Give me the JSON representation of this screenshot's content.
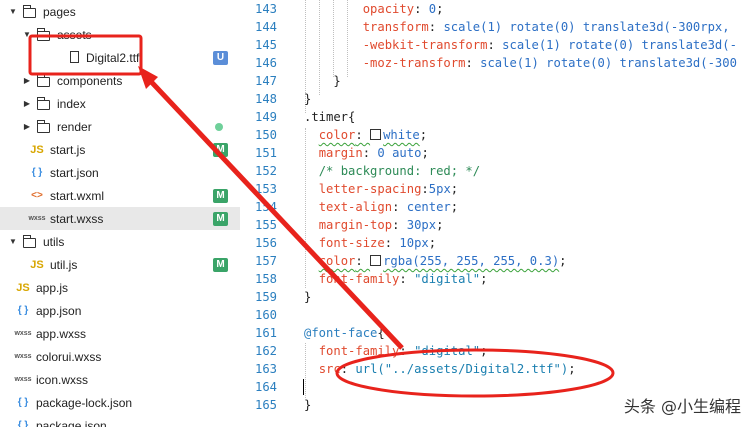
{
  "explorer": {
    "rows": [
      {
        "type": "folder",
        "open": true,
        "depth": 0,
        "label": "pages"
      },
      {
        "type": "folder",
        "open": true,
        "depth": 1,
        "label": "assets"
      },
      {
        "type": "file",
        "kind": "file",
        "depth": 2,
        "label": "Digital2.ttf",
        "badge": "U"
      },
      {
        "type": "folder",
        "open": false,
        "depth": 1,
        "label": "components"
      },
      {
        "type": "folder",
        "open": false,
        "depth": 1,
        "label": "index"
      },
      {
        "type": "folder",
        "open": false,
        "depth": 1,
        "label": "render",
        "dot": true
      },
      {
        "type": "file",
        "kind": "js",
        "depth": 1,
        "label": "start.js",
        "badge": "M"
      },
      {
        "type": "file",
        "kind": "json",
        "depth": 1,
        "label": "start.json"
      },
      {
        "type": "file",
        "kind": "wxml",
        "depth": 1,
        "label": "start.wxml",
        "badge": "M"
      },
      {
        "type": "file",
        "kind": "wxss",
        "depth": 1,
        "label": "start.wxss",
        "badge": "M",
        "selected": true
      },
      {
        "type": "folder",
        "open": true,
        "depth": 0,
        "label": "utils"
      },
      {
        "type": "file",
        "kind": "js",
        "depth": 1,
        "label": "util.js",
        "badge": "M"
      },
      {
        "type": "file",
        "kind": "js",
        "depth": 0,
        "label": "app.js"
      },
      {
        "type": "file",
        "kind": "json",
        "depth": 0,
        "label": "app.json"
      },
      {
        "type": "file",
        "kind": "wxss",
        "depth": 0,
        "label": "app.wxss"
      },
      {
        "type": "file",
        "kind": "wxss",
        "depth": 0,
        "label": "colorui.wxss"
      },
      {
        "type": "file",
        "kind": "wxss",
        "depth": 0,
        "label": "icon.wxss"
      },
      {
        "type": "file",
        "kind": "json",
        "depth": 0,
        "label": "package-lock.json"
      },
      {
        "type": "file",
        "kind": "json",
        "depth": 0,
        "label": "package.json"
      }
    ],
    "icon_glyphs": {
      "js": "JS",
      "json": "{ }",
      "wxml": "<>",
      "wxss": "wxss"
    }
  },
  "editor": {
    "lines": [
      {
        "n": "143",
        "indent": "opacity",
        "t": [
          [
            "        ",
            ""
          ],
          [
            "opacity",
            "prop"
          ],
          [
            ": ",
            ""
          ],
          [
            "0",
            "val"
          ],
          [
            ";",
            ""
          ]
        ]
      },
      {
        "n": "144",
        "t": [
          [
            "        ",
            ""
          ],
          [
            "transform",
            "prop"
          ],
          [
            ": ",
            ""
          ],
          [
            "scale(1) rotate(0) translate3d(-300rpx,",
            "val"
          ]
        ]
      },
      {
        "n": "145",
        "t": [
          [
            "        ",
            ""
          ],
          [
            "-webkit-transform",
            "prop"
          ],
          [
            ": ",
            ""
          ],
          [
            "scale(1) rotate(0) translate3d(-",
            "val"
          ]
        ]
      },
      {
        "n": "146",
        "t": [
          [
            "        ",
            ""
          ],
          [
            "-moz-transform",
            "prop"
          ],
          [
            ": ",
            ""
          ],
          [
            "scale(1) rotate(0) translate3d(-300",
            "val"
          ]
        ]
      },
      {
        "n": "147",
        "t": [
          [
            "    }",
            ""
          ]
        ]
      },
      {
        "n": "148",
        "t": [
          [
            "}",
            ""
          ]
        ]
      },
      {
        "n": "149",
        "t": [
          [
            ".timer{",
            "sel"
          ]
        ]
      },
      {
        "n": "150",
        "t": [
          [
            "  ",
            ""
          ],
          [
            "color",
            "prop sq"
          ],
          [
            ": ",
            "sq"
          ],
          [
            "SWATCH",
            ""
          ],
          [
            "white",
            "val sq"
          ],
          [
            ";",
            ""
          ]
        ]
      },
      {
        "n": "151",
        "t": [
          [
            "  ",
            ""
          ],
          [
            "margin",
            "prop"
          ],
          [
            ": ",
            ""
          ],
          [
            "0 auto",
            "val"
          ],
          [
            ";",
            ""
          ]
        ]
      },
      {
        "n": "152",
        "t": [
          [
            "  ",
            ""
          ],
          [
            "/* background: red; */",
            "cmt"
          ]
        ]
      },
      {
        "n": "153",
        "t": [
          [
            "  ",
            ""
          ],
          [
            "letter-spacing",
            "prop"
          ],
          [
            ":",
            ""
          ],
          [
            "5px",
            "val"
          ],
          [
            ";",
            ""
          ]
        ]
      },
      {
        "n": "154",
        "t": [
          [
            "  ",
            ""
          ],
          [
            "text-align",
            "prop"
          ],
          [
            ": ",
            ""
          ],
          [
            "center",
            "val"
          ],
          [
            ";",
            ""
          ]
        ]
      },
      {
        "n": "155",
        "t": [
          [
            "  ",
            ""
          ],
          [
            "margin-top",
            "prop"
          ],
          [
            ": ",
            ""
          ],
          [
            "30px",
            "val"
          ],
          [
            ";",
            ""
          ]
        ]
      },
      {
        "n": "156",
        "t": [
          [
            "  ",
            ""
          ],
          [
            "font-size",
            "prop"
          ],
          [
            ": ",
            ""
          ],
          [
            "10px",
            "val"
          ],
          [
            ";",
            ""
          ]
        ]
      },
      {
        "n": "157",
        "t": [
          [
            "  ",
            ""
          ],
          [
            "color",
            "prop sq"
          ],
          [
            ": ",
            "sq"
          ],
          [
            "SWATCH",
            ""
          ],
          [
            "rgba(255, 255, 255, 0.3)",
            "val sq"
          ],
          [
            ";",
            ""
          ]
        ]
      },
      {
        "n": "158",
        "t": [
          [
            "  ",
            ""
          ],
          [
            "font-family",
            "prop"
          ],
          [
            ": ",
            ""
          ],
          [
            "\"digital\"",
            "str"
          ],
          [
            ";",
            ""
          ]
        ]
      },
      {
        "n": "159",
        "t": [
          [
            "}",
            ""
          ]
        ]
      },
      {
        "n": "160",
        "t": [
          [
            "",
            ""
          ]
        ]
      },
      {
        "n": "161",
        "t": [
          [
            "@font-face",
            "kw"
          ],
          [
            "{",
            ""
          ]
        ]
      },
      {
        "n": "162",
        "t": [
          [
            "  ",
            ""
          ],
          [
            "font-family",
            "prop"
          ],
          [
            ": ",
            ""
          ],
          [
            "\"digital\"",
            "str"
          ],
          [
            ";",
            ""
          ]
        ]
      },
      {
        "n": "163",
        "t": [
          [
            "  ",
            ""
          ],
          [
            "src",
            "prop"
          ],
          [
            ": ",
            ""
          ],
          [
            "url(\"../assets/Digital2.ttf\")",
            "str"
          ],
          [
            ";",
            ""
          ]
        ]
      },
      {
        "n": "164",
        "t": [
          [
            "",
            ""
          ]
        ]
      },
      {
        "n": "165",
        "t": [
          [
            "}",
            ""
          ]
        ]
      }
    ]
  },
  "colors": {
    "arrow_red": "#e8231c",
    "badge_u": "#5b8ed8",
    "badge_m": "#3aa468"
  },
  "watermark": "头条 @小生编程"
}
